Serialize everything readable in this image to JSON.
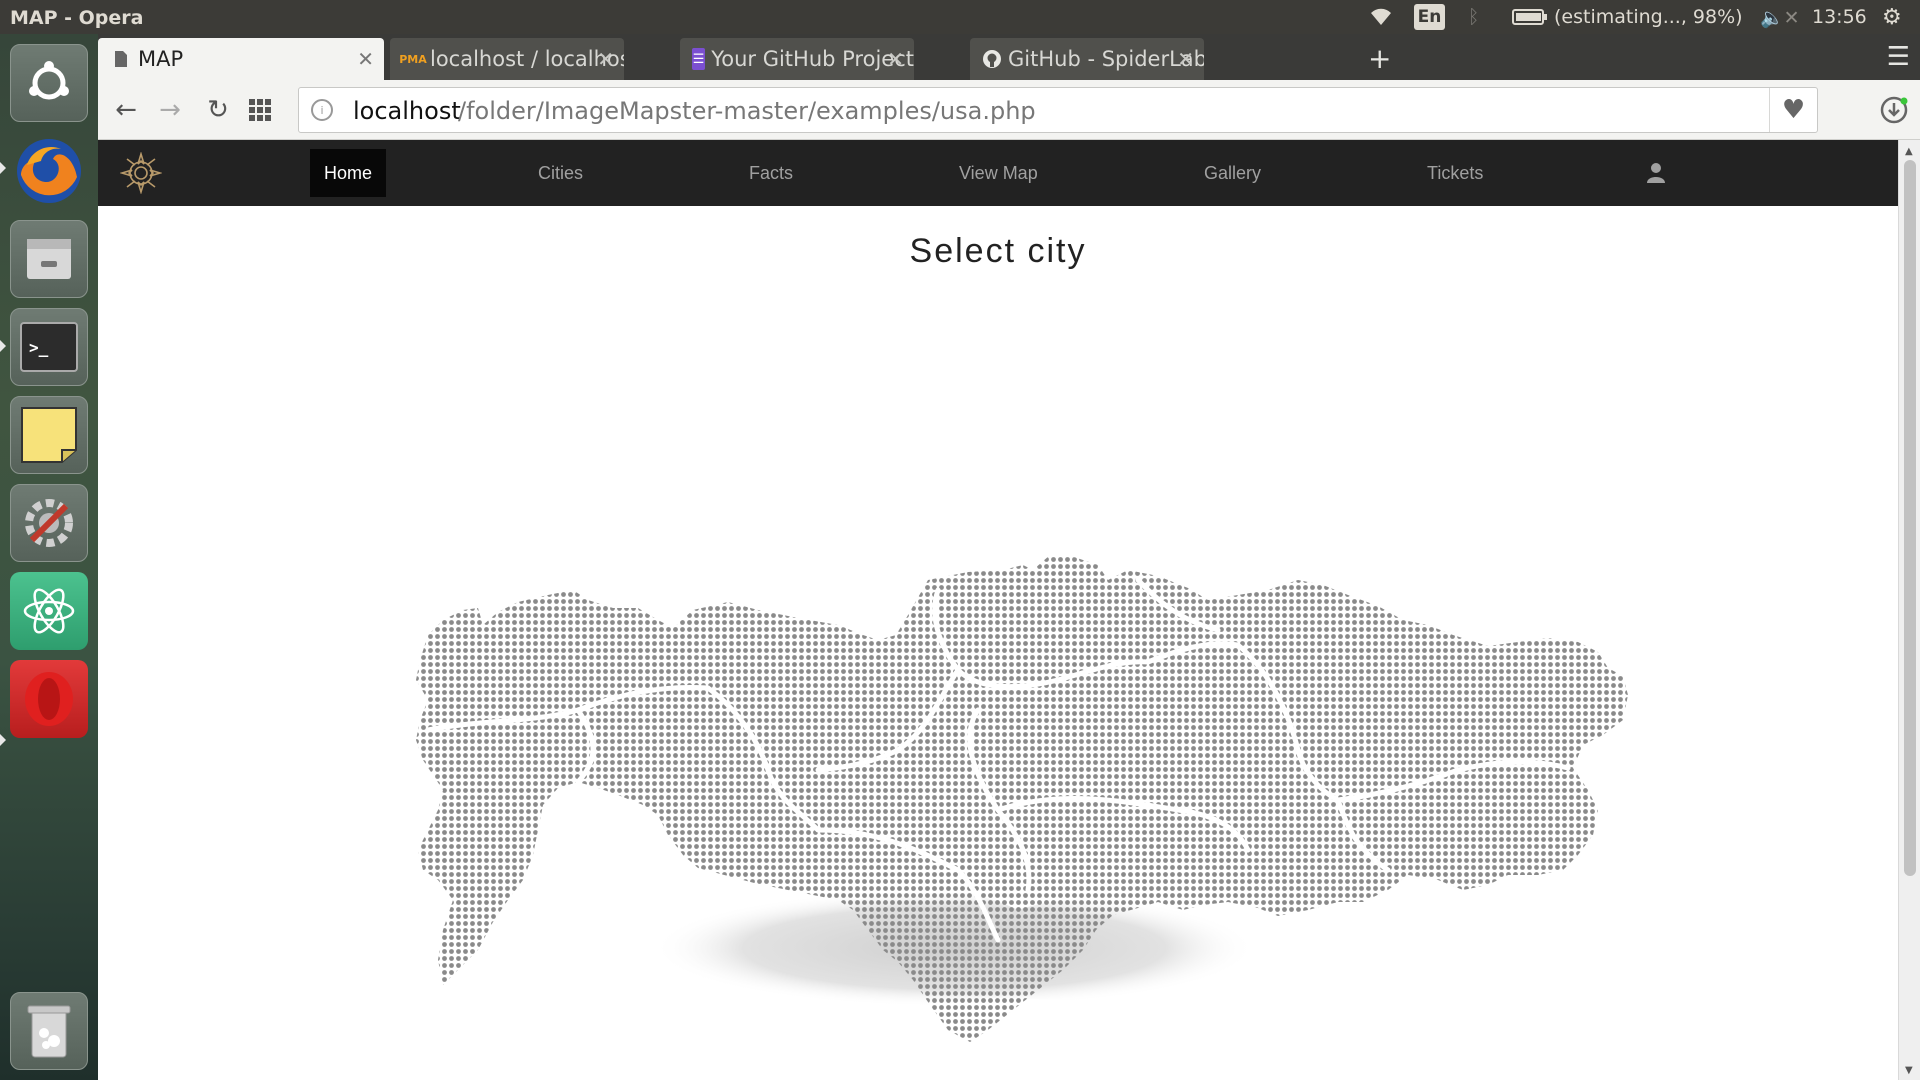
{
  "window": {
    "title": "MAP - Opera"
  },
  "system_tray": {
    "wifi_icon": "wifi-icon",
    "keyboard_layout": "En",
    "bluetooth_icon": "bluetooth-icon",
    "battery_status": "(estimating..., 98%)",
    "volume_icon": "volume-muted-icon",
    "clock": "13:56",
    "settings_icon": "gear-icon"
  },
  "launcher": {
    "items": [
      "ubuntu-dash",
      "firefox",
      "files",
      "terminal",
      "sticky-notes",
      "system-settings",
      "atom",
      "opera",
      "trash"
    ]
  },
  "tabs": [
    {
      "label": "MAP",
      "icon": "page-icon",
      "active": true
    },
    {
      "label": "localhost / localhost /",
      "icon": "phpmyadmin-icon",
      "active": false
    },
    {
      "label": "Your GitHub Project",
      "icon": "list-icon",
      "active": false
    },
    {
      "label": "GitHub - SpiderLabs/I",
      "icon": "github-icon",
      "active": false
    }
  ],
  "address_bar": {
    "domain": "localhost",
    "path": "/folder/ImageMapster-master/examples/usa.php"
  },
  "site_nav": {
    "items": [
      "Home",
      "Cities",
      "Facts",
      "View Map",
      "Gallery",
      "Tickets"
    ],
    "active": "Home"
  },
  "heading": "Select city",
  "colors": {
    "nav_bg": "#222222",
    "map_dots": "#8a8a8a",
    "page_bg": "#ffffff"
  }
}
